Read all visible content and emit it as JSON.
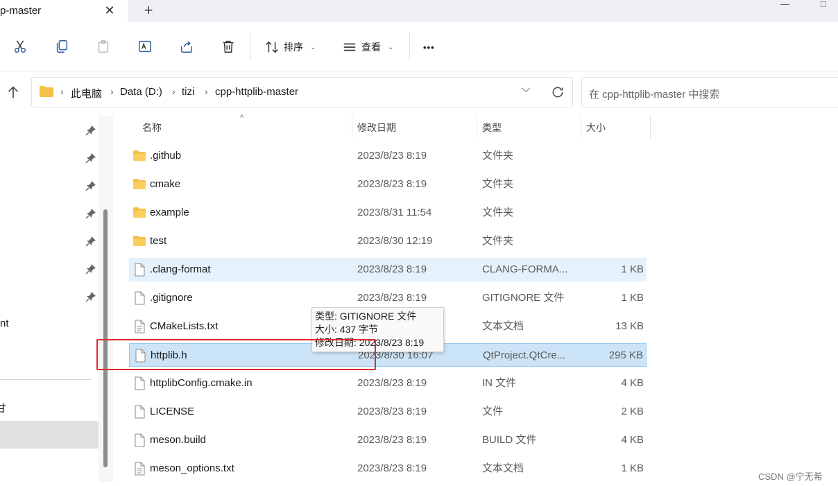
{
  "tab": {
    "title": "p-master",
    "close": "✕",
    "new": "+"
  },
  "window": {
    "minimize": "—",
    "maximize": "□"
  },
  "toolbar": {
    "sort_label": "排序",
    "view_label": "查看",
    "more": "•••"
  },
  "address": {
    "breadcrumbs": [
      "此电脑",
      "Data (D:)",
      "tizi",
      "cpp-httplib-master"
    ],
    "sep": "›",
    "dropdown": "⌵"
  },
  "search": {
    "placeholder": "在 cpp-httplib-master 中搜索"
  },
  "nav": {
    "frag1": "nt",
    "frag2": "甘"
  },
  "columns": {
    "name": "名称",
    "date": "修改日期",
    "type": "类型",
    "size": "大小",
    "sort_indicator": "^"
  },
  "files": [
    {
      "name": ".github",
      "date": "2023/8/23 8:19",
      "type": "文件夹",
      "size": "",
      "kind": "folder"
    },
    {
      "name": "cmake",
      "date": "2023/8/23 8:19",
      "type": "文件夹",
      "size": "",
      "kind": "folder"
    },
    {
      "name": "example",
      "date": "2023/8/31 11:54",
      "type": "文件夹",
      "size": "",
      "kind": "folder"
    },
    {
      "name": "test",
      "date": "2023/8/30 12:19",
      "type": "文件夹",
      "size": "",
      "kind": "folder"
    },
    {
      "name": ".clang-format",
      "date": "2023/8/23 8:19",
      "type": "CLANG-FORMA...",
      "size": "1 KB",
      "kind": "file"
    },
    {
      "name": ".gitignore",
      "date": "2023/8/23 8:19",
      "type": "GITIGNORE 文件",
      "size": "1 KB",
      "kind": "file"
    },
    {
      "name": "CMakeLists.txt",
      "date": "",
      "type": "文本文档",
      "size": "13 KB",
      "kind": "text"
    },
    {
      "name": "httplib.h",
      "date": "2023/8/30 16:07",
      "type": "QtProject.QtCre...",
      "size": "295 KB",
      "kind": "file"
    },
    {
      "name": "httplibConfig.cmake.in",
      "date": "2023/8/23 8:19",
      "type": "IN 文件",
      "size": "4 KB",
      "kind": "file"
    },
    {
      "name": "LICENSE",
      "date": "2023/8/23 8:19",
      "type": "文件",
      "size": "2 KB",
      "kind": "file"
    },
    {
      "name": "meson.build",
      "date": "2023/8/23 8:19",
      "type": "BUILD 文件",
      "size": "4 KB",
      "kind": "file"
    },
    {
      "name": "meson_options.txt",
      "date": "2023/8/23 8:19",
      "type": "文本文档",
      "size": "1 KB",
      "kind": "text"
    }
  ],
  "tooltip": {
    "type_line": "类型: GITIGNORE 文件",
    "size_line": "大小: 437 字节",
    "date_line": "修改日期: 2023/8/23 8:19"
  },
  "watermark": "CSDN @宁无希",
  "colors": {
    "selected_row": "#cce4f7",
    "hover_row": "#e5f1fb",
    "folder": "#f4c048",
    "annotation_box": "#e02b2b"
  }
}
